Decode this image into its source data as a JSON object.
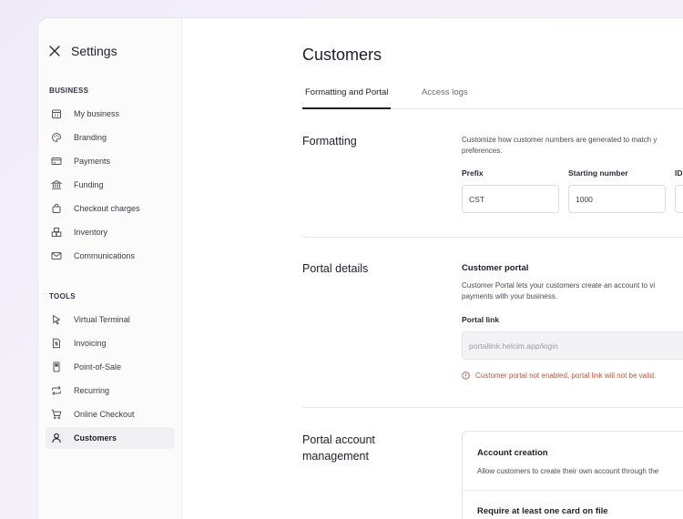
{
  "sidebar": {
    "title": "Settings",
    "close_icon": "close-icon",
    "sections": {
      "business": "BUSINESS",
      "tools": "TOOLS"
    },
    "business_items": [
      {
        "label": "My business",
        "icon": "calendar-grid-icon"
      },
      {
        "label": "Branding",
        "icon": "palette-icon"
      },
      {
        "label": "Payments",
        "icon": "credit-card-icon"
      },
      {
        "label": "Funding",
        "icon": "bank-icon"
      },
      {
        "label": "Checkout charges",
        "icon": "shopping-bag-icon"
      },
      {
        "label": "Inventory",
        "icon": "boxes-icon"
      },
      {
        "label": "Communications",
        "icon": "envelope-icon"
      }
    ],
    "tools_items": [
      {
        "label": "Virtual Terminal",
        "icon": "cursor-icon"
      },
      {
        "label": "Invoicing",
        "icon": "invoice-icon"
      },
      {
        "label": "Point-of-Sale",
        "icon": "pos-device-icon"
      },
      {
        "label": "Recurring",
        "icon": "repeat-icon"
      },
      {
        "label": "Online Checkout",
        "icon": "cart-icon"
      },
      {
        "label": "Customers",
        "icon": "user-icon",
        "active": true
      }
    ]
  },
  "main": {
    "title": "Customers",
    "tabs": [
      {
        "label": "Formatting and Portal",
        "active": true
      },
      {
        "label": "Access logs",
        "active": false
      }
    ],
    "formatting": {
      "title": "Formatting",
      "description_line1": "Customize how customer numbers are generated to match y",
      "description_line2": "preferences.",
      "prefix_label": "Prefix",
      "prefix_value": "CST",
      "starting_label": "Starting number",
      "starting_value": "1000",
      "id_label": "ID"
    },
    "portal": {
      "title": "Portal details",
      "subtitle": "Customer portal",
      "description_line1": "Customer Portal lets your customers create an account to vi",
      "description_line2": "payments with your business.",
      "link_label": "Portal link",
      "link_placeholder": "portallink.helcim.app/login",
      "warning": "Customer portal not enabled, portal link will not be valid."
    },
    "account": {
      "title_line1": "Portal account",
      "title_line2": "management",
      "creation_title": "Account creation",
      "creation_desc": "Allow customers to create their own account through the",
      "card_title": "Require at least one card on file"
    }
  },
  "colors": {
    "accent": "#1f1d2b",
    "warning": "#b4593f",
    "background": "#efeaf8"
  }
}
